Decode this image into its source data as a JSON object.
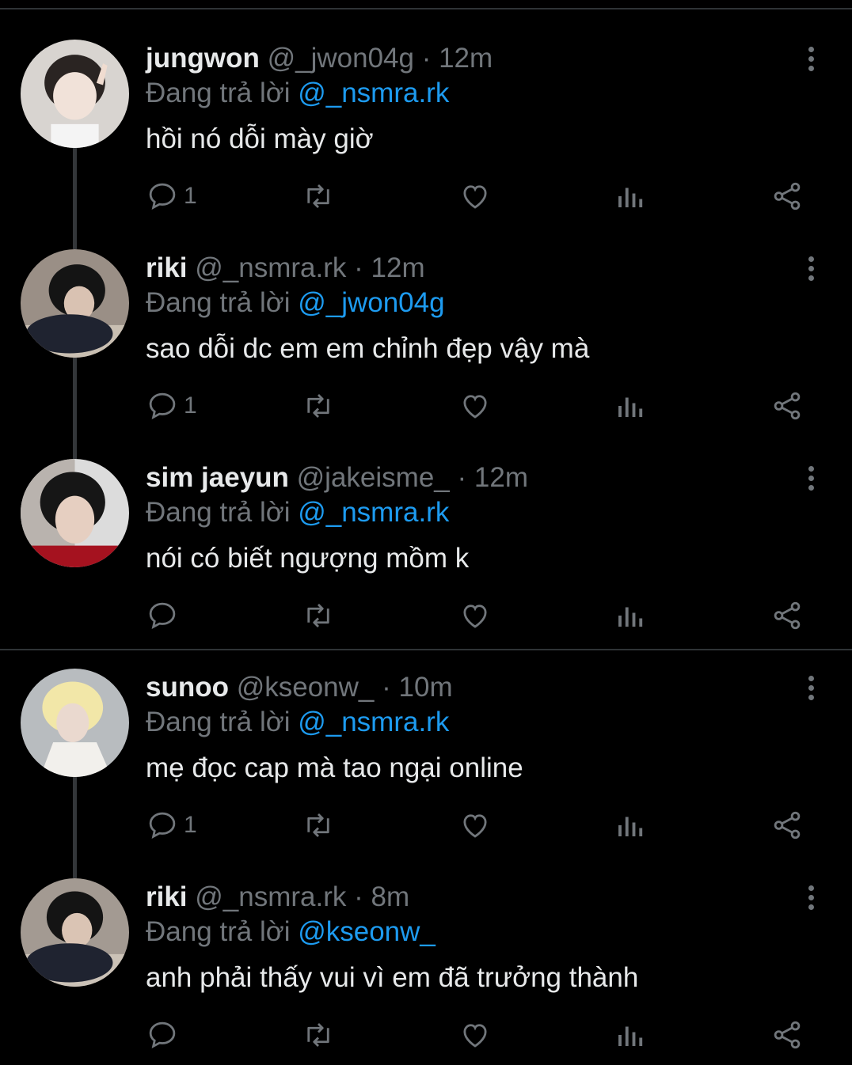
{
  "tweets": [
    {
      "name": "jungwon",
      "handle": "@_jwon04g",
      "time": "12m",
      "reply_prefix": "Đang trả lời ",
      "reply_to": "@_nsmra.rk",
      "text": "hồi nó dỗi mày giờ",
      "reply_count": "1"
    },
    {
      "name": "riki",
      "handle": "@_nsmra.rk",
      "time": "12m",
      "reply_prefix": "Đang trả lời ",
      "reply_to": "@_jwon04g",
      "text": "sao dỗi dc em em chỉnh đẹp vậy mà",
      "reply_count": "1"
    },
    {
      "name": "sim jaeyun",
      "handle": "@jakeisme_",
      "time": "12m",
      "reply_prefix": "Đang trả lời ",
      "reply_to": "@_nsmra.rk",
      "text": "nói có biết ngượng mồm k",
      "reply_count": ""
    },
    {
      "name": "sunoo",
      "handle": "@kseonw_",
      "time": "10m",
      "reply_prefix": "Đang trả lời ",
      "reply_to": "@_nsmra.rk",
      "text": "mẹ đọc cap mà tao ngại online",
      "reply_count": "1"
    },
    {
      "name": "riki",
      "handle": "@_nsmra.rk",
      "time": "8m",
      "reply_prefix": "Đang trả lời ",
      "reply_to": "@kseonw_",
      "text": "anh phải thấy vui vì em đã trưởng thành",
      "reply_count": ""
    }
  ],
  "separator": "·",
  "icons": {
    "reply": "comment-icon",
    "retweet": "retweet-icon",
    "like": "heart-icon",
    "views": "views-icon",
    "share": "share-icon",
    "more": "more-vertical-icon"
  },
  "colors": {
    "background": "#000000",
    "text": "#e7e9ea",
    "muted": "#71767b",
    "mention": "#1d9bf0",
    "line": "#333639"
  }
}
